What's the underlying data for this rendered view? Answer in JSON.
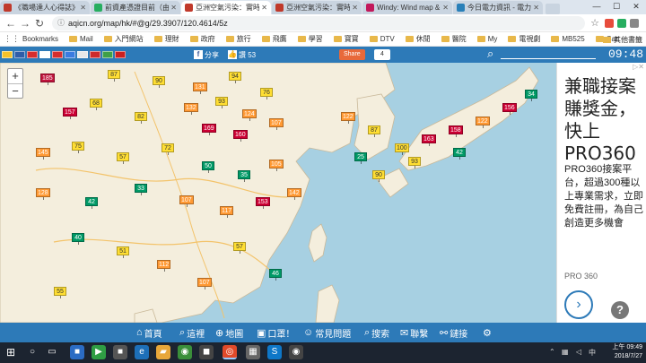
{
  "browser": {
    "tabs": [
      {
        "label": "《職場達人心得誌》",
        "favicon": "#c0392b",
        "active": false
      },
      {
        "label": "前資產憑證目前（由",
        "favicon": "#27ae60",
        "active": false
      },
      {
        "label": "亞洲空氣污染：實時",
        "favicon": "#c0392b",
        "active": true
      },
      {
        "label": "亞洲空氣污染：實時",
        "favicon": "#c0392b",
        "active": false
      },
      {
        "label": "Windy: Wind map &",
        "favicon": "#c2185b",
        "active": false
      },
      {
        "label": "今日電力資訊 - 電力",
        "favicon": "#2980b9",
        "active": false
      }
    ],
    "url": "aqicn.org/map/hk/#@g/29.3907/120.4614/5z",
    "bookmarks": [
      "Bookmarks",
      "Mail",
      "入門網站",
      "理財",
      "政府",
      "旅行",
      "飛鷹",
      "學習",
      "寶寶",
      "DTV",
      "休閒",
      "醫院",
      "My",
      "電視劇",
      "MB525",
      "Car"
    ],
    "other_bookmarks": "其他書籤",
    "apps_label": "Bookmarks"
  },
  "site": {
    "flags": [
      "#f3c22b",
      "#2f5da8",
      "#d62d2d",
      "#ffffff",
      "#d62d2d",
      "#3a7be0",
      "#e8e8e8",
      "#cc2a2a",
      "#3fa046",
      "#cc1f1f"
    ],
    "fb_share_label": "分享",
    "like_count": "讚 53",
    "share_button": "Share",
    "share_count": "4",
    "clock": "09:48"
  },
  "map": {
    "zoom_in": "+",
    "zoom_out": "−",
    "markers": [
      {
        "v": "185",
        "c": "#c0143c"
      },
      {
        "v": "87",
        "c": "#ffde33"
      },
      {
        "v": "90",
        "c": "#ffde33"
      },
      {
        "v": "131",
        "c": "#ff9933"
      },
      {
        "v": "94",
        "c": "#ffde33"
      },
      {
        "v": "76",
        "c": "#ffde33"
      },
      {
        "v": "157",
        "c": "#cc0033"
      },
      {
        "v": "68",
        "c": "#ffde33"
      },
      {
        "v": "82",
        "c": "#ffde33"
      },
      {
        "v": "132",
        "c": "#ff9933"
      },
      {
        "v": "93",
        "c": "#ffde33"
      },
      {
        "v": "124",
        "c": "#ff9933"
      },
      {
        "v": "169",
        "c": "#cc0033"
      },
      {
        "v": "160",
        "c": "#cc0033"
      },
      {
        "v": "107",
        "c": "#ff9933"
      },
      {
        "v": "145",
        "c": "#ff9933"
      },
      {
        "v": "75",
        "c": "#ffde33"
      },
      {
        "v": "57",
        "c": "#ffde33"
      },
      {
        "v": "72",
        "c": "#ffde33"
      },
      {
        "v": "50",
        "c": "#009966"
      },
      {
        "v": "35",
        "c": "#009966"
      },
      {
        "v": "105",
        "c": "#ff9933"
      },
      {
        "v": "128",
        "c": "#ff9933"
      },
      {
        "v": "42",
        "c": "#009966"
      },
      {
        "v": "33",
        "c": "#009966"
      },
      {
        "v": "107",
        "c": "#ff9933"
      },
      {
        "v": "117",
        "c": "#ff9933"
      },
      {
        "v": "153",
        "c": "#cc0033"
      },
      {
        "v": "142",
        "c": "#ff9933"
      },
      {
        "v": "122",
        "c": "#ff9933"
      },
      {
        "v": "87",
        "c": "#ffde33"
      },
      {
        "v": "100",
        "c": "#ffde33"
      },
      {
        "v": "163",
        "c": "#cc0033"
      },
      {
        "v": "158",
        "c": "#cc0033"
      },
      {
        "v": "122",
        "c": "#ff9933"
      },
      {
        "v": "156",
        "c": "#cc0033"
      },
      {
        "v": "34",
        "c": "#009966"
      },
      {
        "v": "25",
        "c": "#009966"
      },
      {
        "v": "90",
        "c": "#ffde33"
      },
      {
        "v": "93",
        "c": "#ffde33"
      },
      {
        "v": "42",
        "c": "#009966"
      },
      {
        "v": "40",
        "c": "#009966"
      },
      {
        "v": "51",
        "c": "#ffde33"
      },
      {
        "v": "112",
        "c": "#ff9933"
      },
      {
        "v": "107",
        "c": "#ff9933"
      },
      {
        "v": "57",
        "c": "#ffde33"
      },
      {
        "v": "46",
        "c": "#009966"
      },
      {
        "v": "55",
        "c": "#ffde33"
      }
    ]
  },
  "ad": {
    "headline": "兼職接案賺獎金，快上PRO360",
    "body": "PRO360接案平台，超過300種以上專業需求，立即免費註冊，為自己創造更多機會",
    "brand": "PRO 360",
    "arrow": "›",
    "help": "?"
  },
  "bottom_nav": [
    {
      "icon": "⌂",
      "label": "首頁"
    },
    {
      "icon": "⌕",
      "label": "這裡"
    },
    {
      "icon": "⊕",
      "label": "地圖"
    },
    {
      "icon": "▣",
      "label": "口罩！"
    },
    {
      "icon": "☺",
      "label": "常見問題"
    },
    {
      "icon": "⌕",
      "label": "搜索"
    },
    {
      "icon": "✉",
      "label": "聯繫"
    },
    {
      "icon": "⚯",
      "label": "鏈接"
    },
    {
      "icon": "⚙",
      "label": ""
    }
  ],
  "taskbar": {
    "time_line1": "上午 09:49",
    "time_line2": "2018/7/27"
  }
}
